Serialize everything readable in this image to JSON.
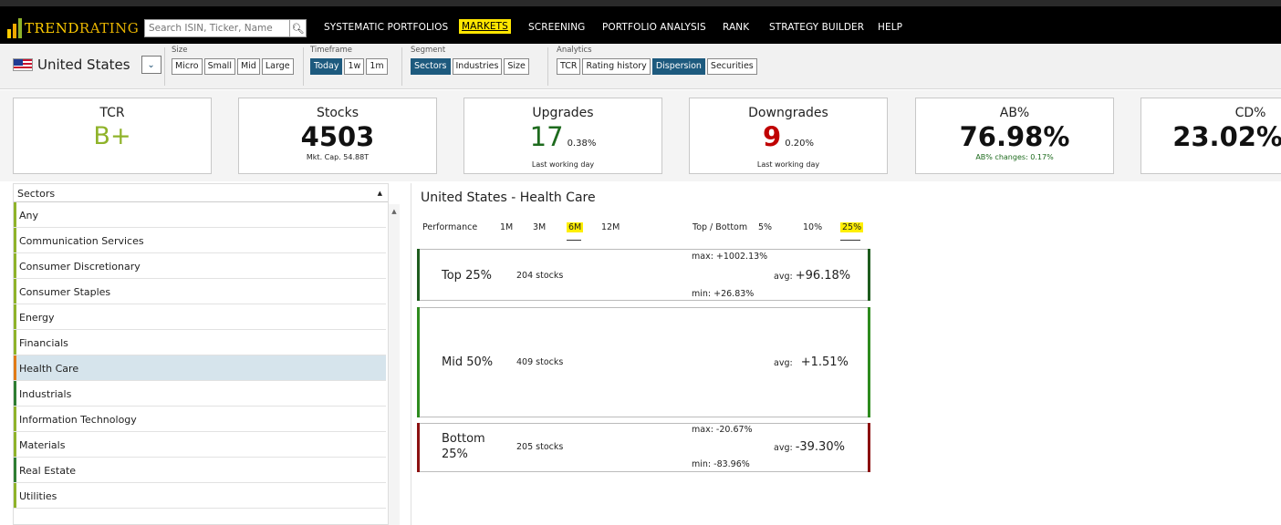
{
  "app": {
    "logo_text_1": "TREND",
    "logo_text_2": "RATING"
  },
  "search": {
    "placeholder": "Search ISIN, Ticker, Name"
  },
  "nav": {
    "items": [
      {
        "label": "SYSTEMATIC PORTFOLIOS"
      },
      {
        "label": "MARKETS",
        "active": true
      },
      {
        "label": "SCREENING"
      },
      {
        "label": "PORTFOLIO ANALYSIS"
      },
      {
        "label": "RANK"
      },
      {
        "label": "STRATEGY BUILDER"
      },
      {
        "label": "HELP"
      }
    ]
  },
  "toolbar": {
    "country": "United States",
    "size": {
      "label": "Size",
      "options": [
        "Micro",
        "Small",
        "Mid",
        "Large"
      ]
    },
    "timeframe": {
      "label": "Timeframe",
      "options": [
        "Today",
        "1w",
        "1m"
      ],
      "selected": "Today"
    },
    "segment": {
      "label": "Segment",
      "options": [
        "Sectors",
        "Industries",
        "Size"
      ],
      "selected": "Sectors"
    },
    "analytics": {
      "label": "Analytics",
      "options": [
        "TCR",
        "Rating history",
        "Dispersion",
        "Securities"
      ],
      "selected": "Dispersion"
    }
  },
  "kpis": {
    "tcr": {
      "title": "TCR",
      "value": "B+"
    },
    "stocks": {
      "title": "Stocks",
      "value": "4503",
      "sub": "Mkt. Cap. 54.88T"
    },
    "upgrades": {
      "title": "Upgrades",
      "value": "17",
      "pct": "0.38%",
      "sub": "Last working day"
    },
    "downgrades": {
      "title": "Downgrades",
      "value": "9",
      "pct": "0.20%",
      "sub": "Last working day"
    },
    "ab": {
      "title": "AB%",
      "value": "76.98%",
      "sub": "AB% changes: 0.17%"
    },
    "cd": {
      "title": "CD%",
      "value": "23.02%"
    }
  },
  "sectors": {
    "header": "Sectors",
    "items": [
      {
        "label": "Any",
        "color": "#8fb32a"
      },
      {
        "label": "Communication Services",
        "color": "#8fb32a"
      },
      {
        "label": "Consumer Discretionary",
        "color": "#8fb32a"
      },
      {
        "label": "Consumer Staples",
        "color": "#8fb32a"
      },
      {
        "label": "Energy",
        "color": "#8fb32a"
      },
      {
        "label": "Financials",
        "color": "#8fb32a"
      },
      {
        "label": "Health Care",
        "color": "#e07a16",
        "selected": true
      },
      {
        "label": "Industrials",
        "color": "#2e7d32"
      },
      {
        "label": "Information Technology",
        "color": "#8fb32a"
      },
      {
        "label": "Materials",
        "color": "#8fb32a"
      },
      {
        "label": "Real Estate",
        "color": "#2e7d32"
      },
      {
        "label": "Utilities",
        "color": "#8fb32a"
      }
    ]
  },
  "dispersion": {
    "title": "United States - Health Care",
    "performance_label": "Performance",
    "performance_options": [
      "1M",
      "3M",
      "6M",
      "12M"
    ],
    "performance_selected": "6M",
    "topbottom_label": "Top / Bottom",
    "topbottom_options": [
      "5%",
      "10%",
      "25%"
    ],
    "topbottom_selected": "25%",
    "buckets": [
      {
        "name": "Top 25%",
        "count": "204 stocks",
        "max": "max: +1002.13%",
        "min": "min: +26.83%",
        "avg_label": "avg:",
        "avg": "+96.18%",
        "color": "#1e5c1e"
      },
      {
        "name": "Mid 50%",
        "count": "409 stocks",
        "avg_label": "avg:",
        "avg": "+1.51%",
        "color": "#2e8b1e"
      },
      {
        "name_1": "Bottom",
        "name_2": "25%",
        "count": "205 stocks",
        "max": "max: -20.67%",
        "min": "min: -83.96%",
        "avg_label": "avg:",
        "avg": "-39.30%",
        "color": "#8b1010"
      }
    ]
  },
  "colors": {
    "accent": "#1d5a7e",
    "nav_active": "#ffe600",
    "tcr_green": "#8fb32a",
    "up_green": "#1e6b1e",
    "down_red": "#c00000"
  }
}
